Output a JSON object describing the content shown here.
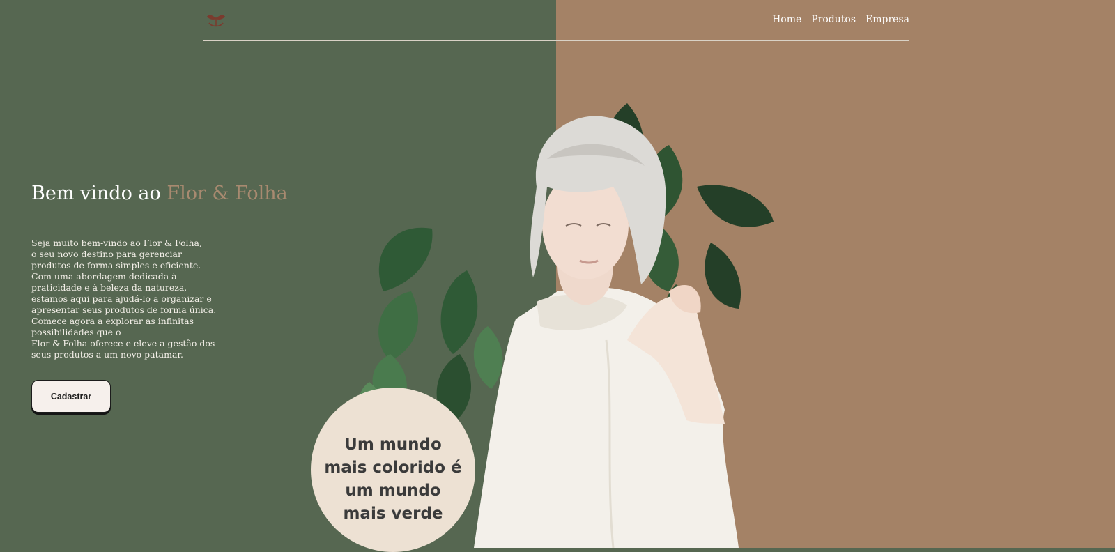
{
  "header": {
    "logo_icon": "sprout-icon",
    "nav": [
      {
        "label": "Home"
      },
      {
        "label": "Produtos"
      },
      {
        "label": "Empresa"
      }
    ]
  },
  "hero": {
    "title_prefix": "Bem vindo ao",
    "title_brand": "Flor & Folha",
    "paragraph_lines": [
      "Seja muito bem-vindo ao Flor & Folha,",
      "o seu novo destino para gerenciar",
      "produtos de forma simples e eficiente.",
      "Com uma abordagem dedicada à",
      "praticidade e à beleza da natureza,",
      "estamos aqui para ajudá-lo a organizar e",
      "apresentar seus produtos de forma única.",
      "Comece agora a explorar as infinitas",
      "possibilidades que o",
      "Flor & Folha oferece e eleve a gestão dos",
      "seus produtos a um novo patamar."
    ],
    "cta_label": "Cadastrar"
  },
  "illustration": {
    "subject": "woman-with-leaves-image",
    "slogan_lines": [
      "Um mundo",
      "mais colorido é",
      "um mundo",
      "mais verde"
    ]
  },
  "colors": {
    "green": "#566751",
    "tan": "#a48266",
    "brand_accent": "#a88a70",
    "circle": "#ede1d3"
  }
}
